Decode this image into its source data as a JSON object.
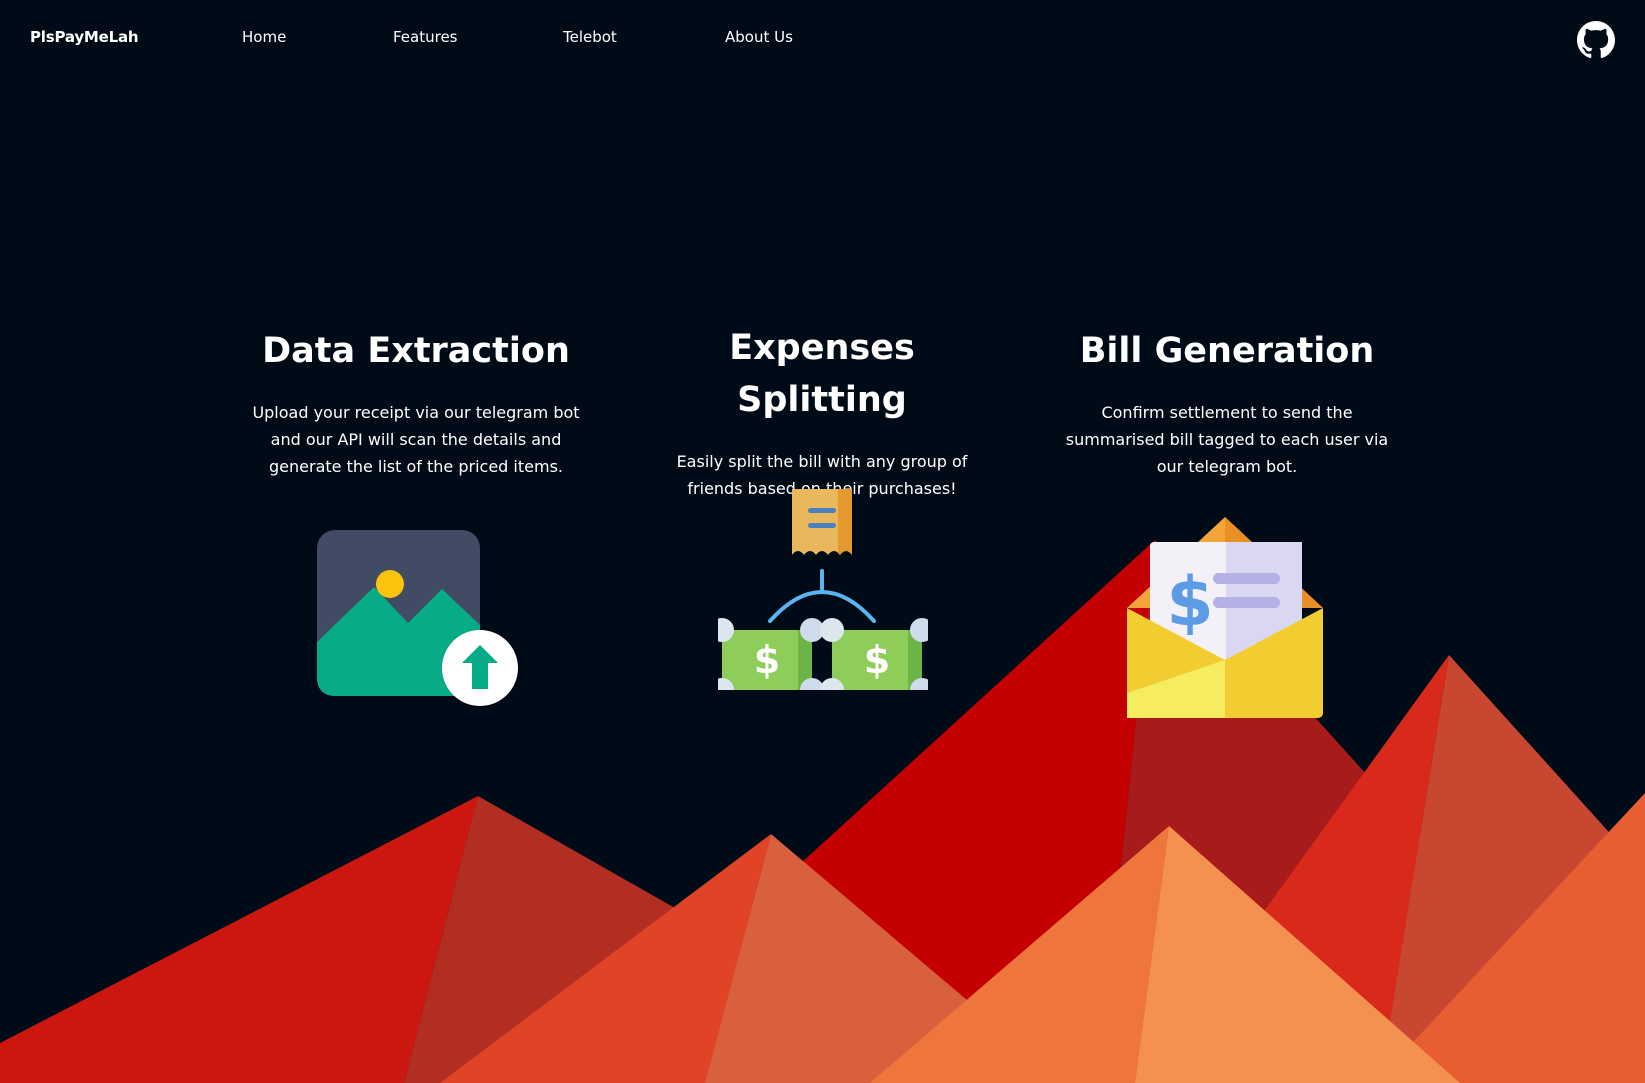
{
  "navbar": {
    "brand": "PlsPayMeLah",
    "links": [
      {
        "label": "Home"
      },
      {
        "label": "Features"
      },
      {
        "label": "Telebot"
      },
      {
        "label": "About Us"
      }
    ],
    "github_icon": "github-icon"
  },
  "features": [
    {
      "title": "Data Extraction",
      "description": "Upload your receipt via our telegram bot and our API will scan the details and generate the list of the priced items.",
      "icon": "image-upload-icon"
    },
    {
      "title": "Expenses Splitting",
      "description": "Easily split the bill with any group of friends based on their purchases!",
      "icon": "split-bill-icon"
    },
    {
      "title": "Bill Generation",
      "description": "Confirm settlement to send the summarised bill tagged to each user via our telegram bot.",
      "icon": "envelope-bill-icon"
    }
  ],
  "colors": {
    "background": "#000b18",
    "text": "#ffffff",
    "mountain_red": "#c20000",
    "mountain_orange": "#e2452a",
    "mountain_light": "#f59150"
  }
}
